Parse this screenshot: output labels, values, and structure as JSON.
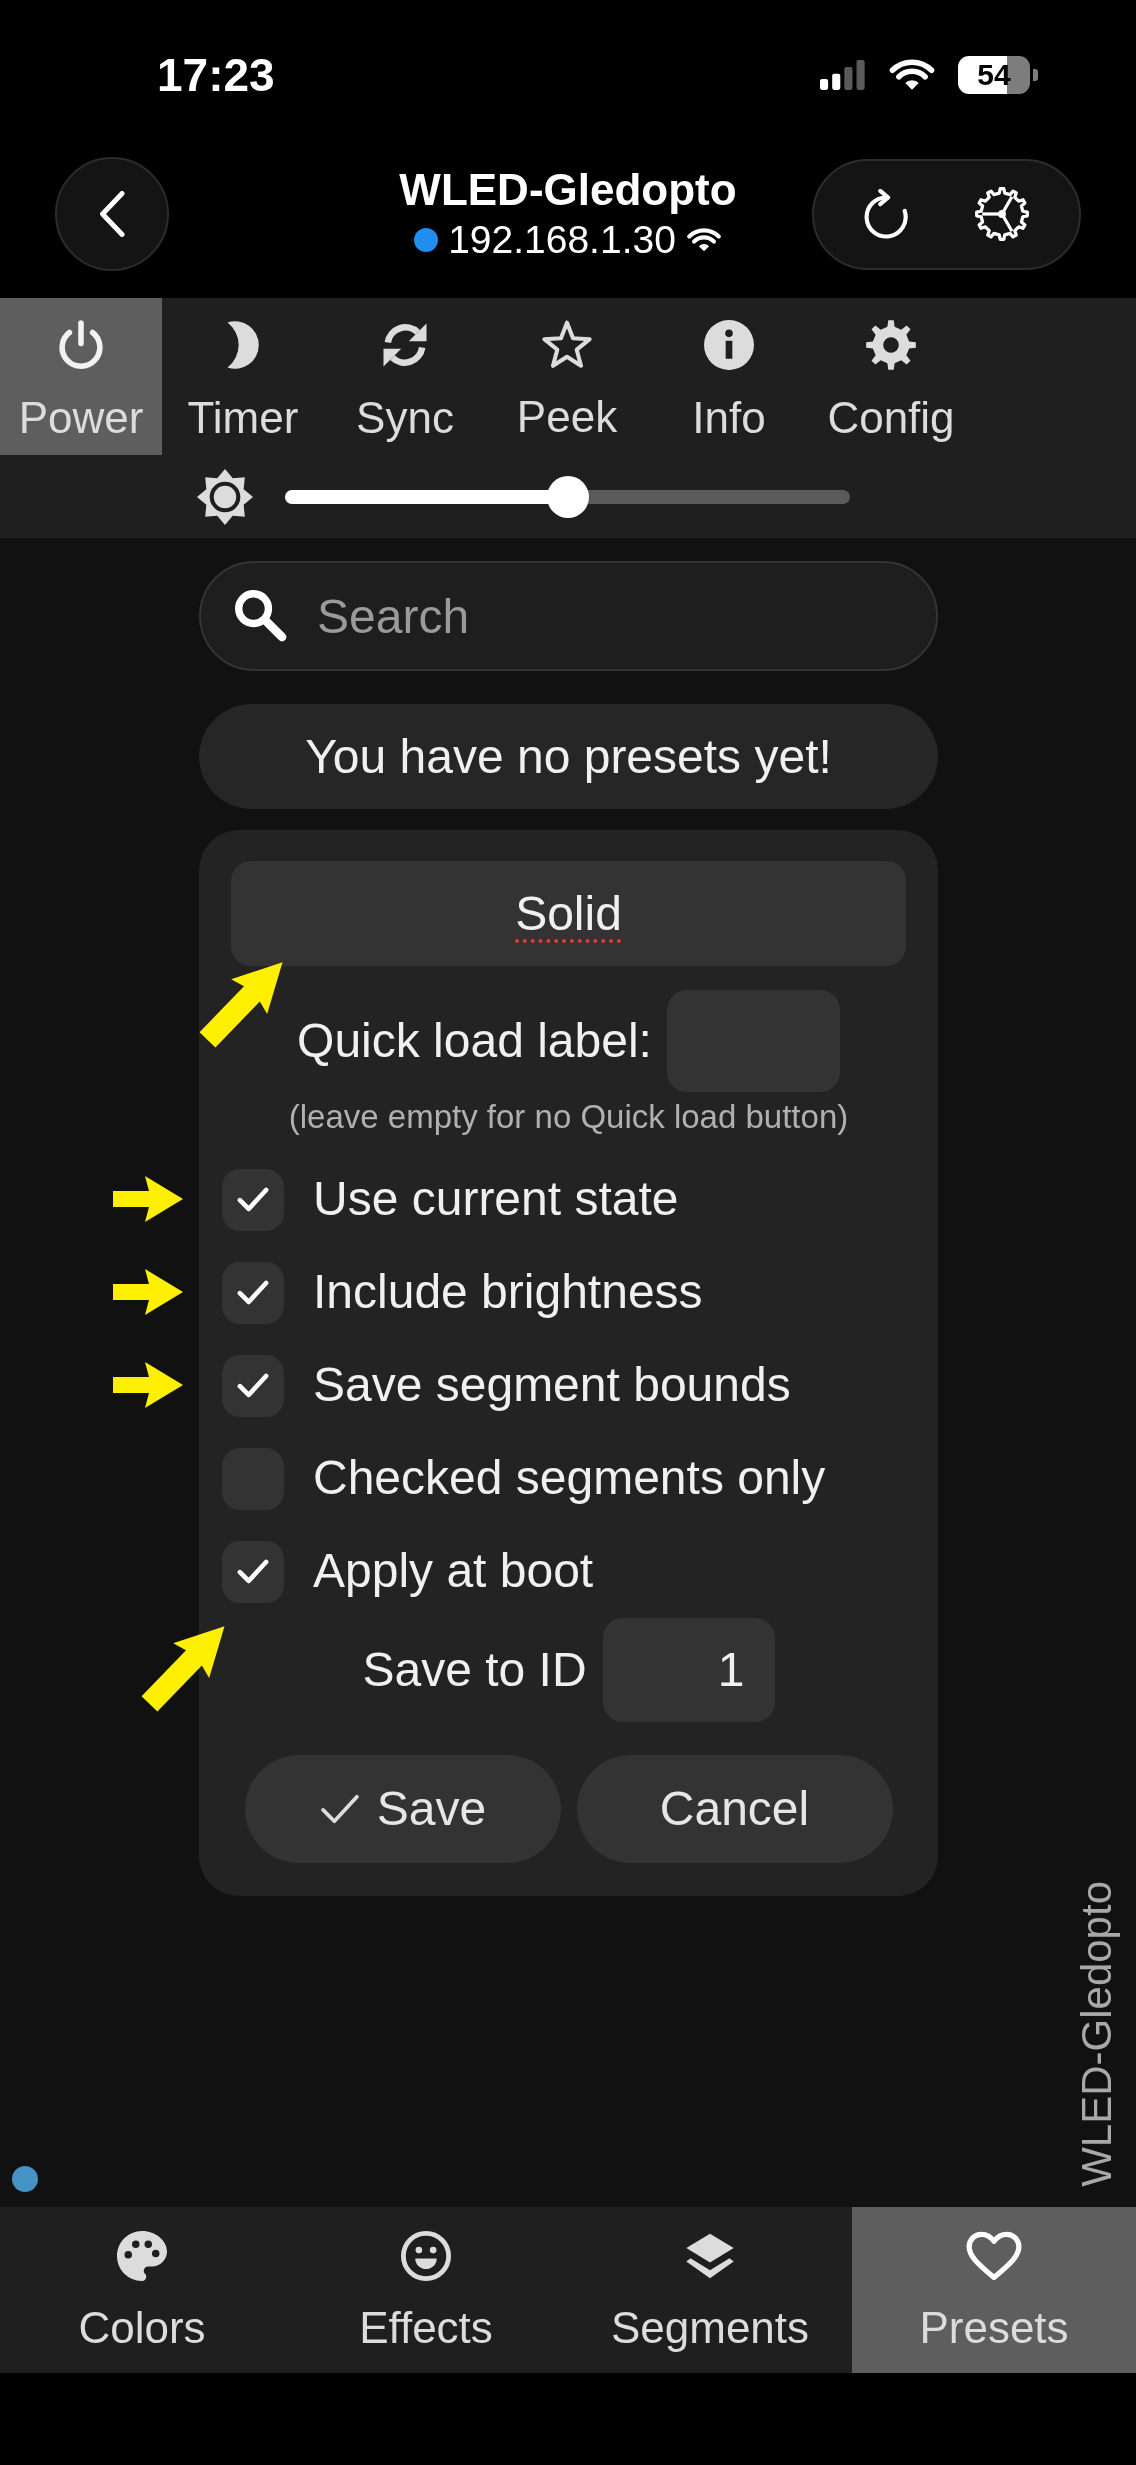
{
  "status_bar": {
    "time": "17:23",
    "battery": "54"
  },
  "header": {
    "title": "WLED-Gledopto",
    "address": "192.168.1.30"
  },
  "top_tabs": [
    {
      "label": "Power",
      "selected": true
    },
    {
      "label": "Timer",
      "selected": false
    },
    {
      "label": "Sync",
      "selected": false
    },
    {
      "label": "Peek",
      "selected": false
    },
    {
      "label": "Info",
      "selected": false
    },
    {
      "label": "Config",
      "selected": false
    }
  ],
  "brightness": {
    "level": 0.5
  },
  "search": {
    "placeholder": "Search"
  },
  "presets_message": "You have no presets yet!",
  "preset_form": {
    "name": {
      "value": "Solid",
      "spellcheck_error": true,
      "arrow": true,
      "arrow_tilted": true
    },
    "quick_load": {
      "label": "Quick load label:",
      "hint": "(leave empty for no Quick load button)"
    },
    "options": [
      {
        "label": "Use current state",
        "checked": true,
        "arrow": true,
        "arrow_tilted": false
      },
      {
        "label": "Include brightness",
        "checked": true,
        "arrow": true,
        "arrow_tilted": false
      },
      {
        "label": "Save segment bounds",
        "checked": true,
        "arrow": true,
        "arrow_tilted": false
      },
      {
        "label": "Checked segments only",
        "checked": false,
        "arrow": false
      },
      {
        "label": "Apply at boot",
        "checked": true,
        "arrow": true,
        "arrow_tilted": true
      }
    ],
    "save_id": {
      "label": "Save to ID",
      "value": "1"
    },
    "buttons": [
      {
        "label": "Save",
        "kind": "confirm"
      },
      {
        "label": "Cancel",
        "kind": "dismiss"
      }
    ]
  },
  "side_label": "WLED-Gledopto",
  "bottom_tabs": [
    {
      "label": "Colors",
      "selected": false
    },
    {
      "label": "Effects",
      "selected": false
    },
    {
      "label": "Segments",
      "selected": false
    },
    {
      "label": "Presets",
      "selected": true
    }
  ]
}
